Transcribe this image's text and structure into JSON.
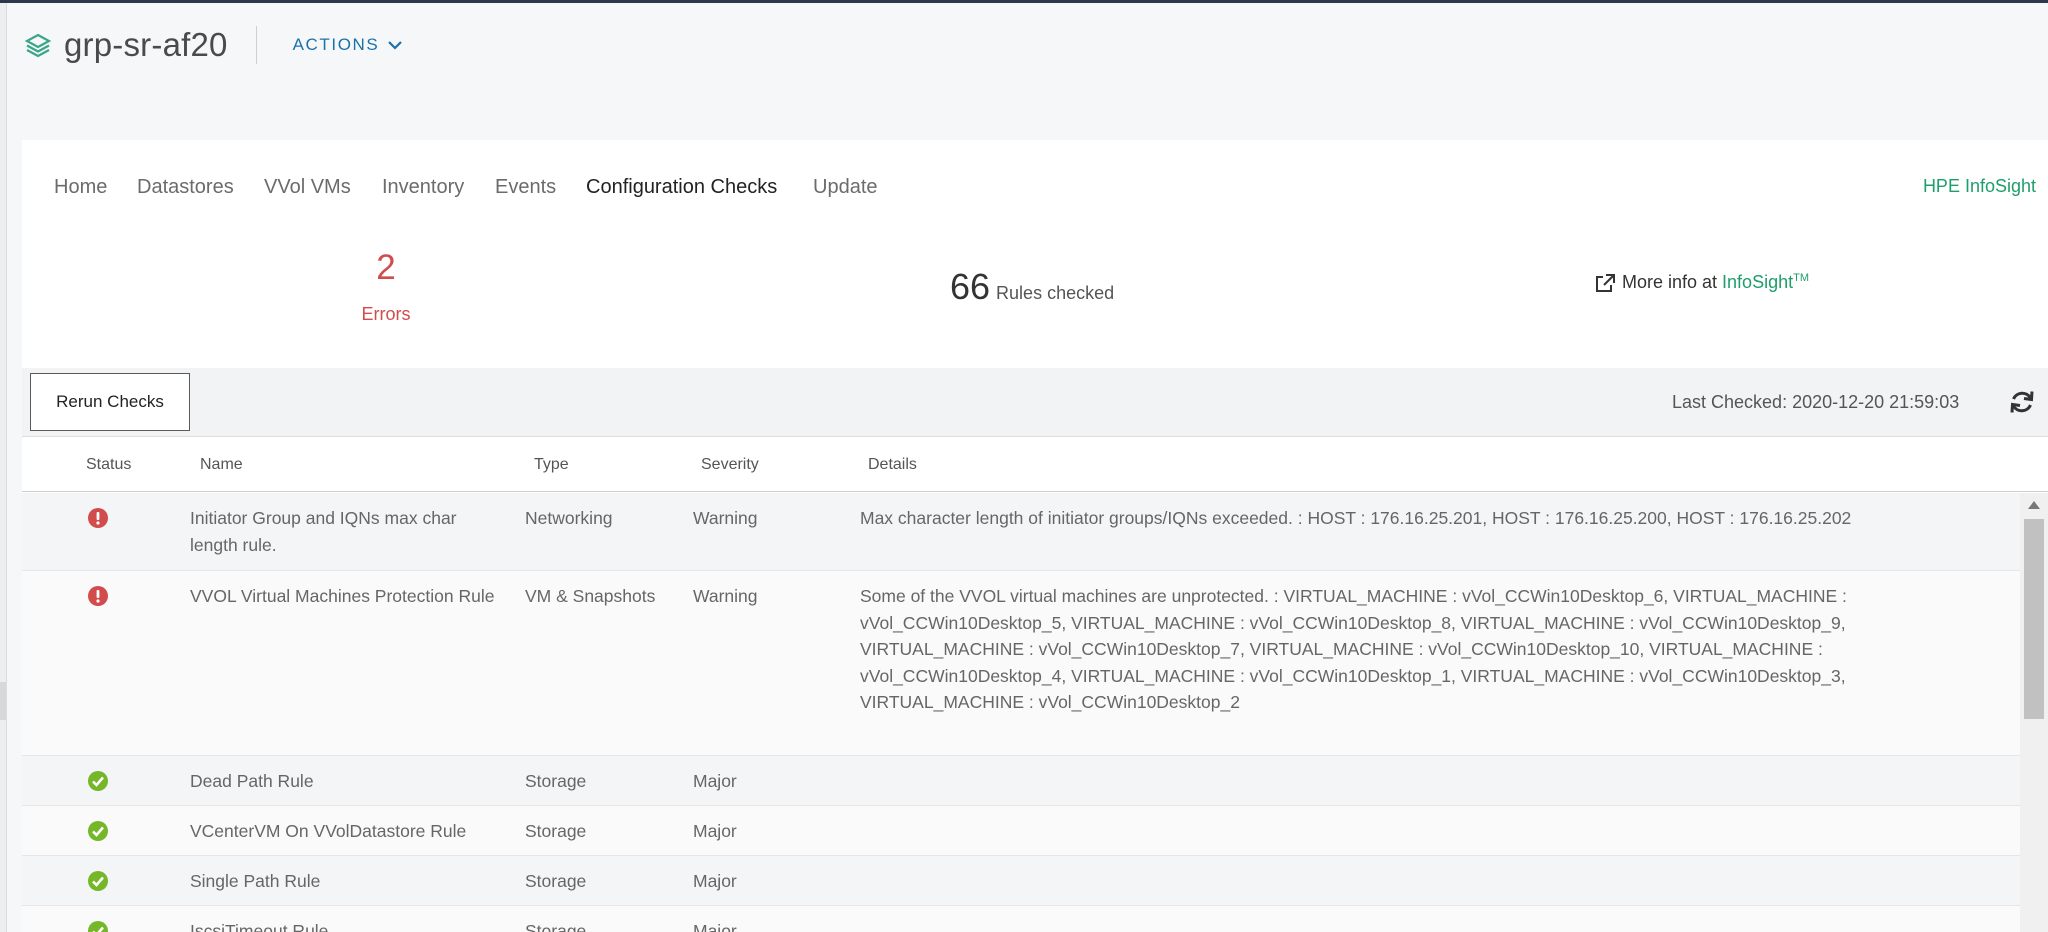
{
  "header": {
    "title": "grp-sr-af20",
    "actions_label": "ACTIONS"
  },
  "tabs": [
    {
      "label": "Home"
    },
    {
      "label": "Datastores"
    },
    {
      "label": "VVol VMs"
    },
    {
      "label": "Inventory"
    },
    {
      "label": "Events"
    },
    {
      "label": "Configuration Checks"
    },
    {
      "label": "Update"
    }
  ],
  "active_tab": "Configuration Checks",
  "infosight_link": "HPE InfoSight",
  "summary": {
    "errors_count": "2",
    "errors_label": "Errors",
    "rules_count": "66",
    "rules_label": "Rules checked",
    "more_info_prefix": "More info at",
    "more_info_link": "InfoSight",
    "more_info_tm": "TM"
  },
  "toolbar": {
    "rerun_label": "Rerun Checks",
    "last_checked": "Last Checked: 2020-12-20 21:59:03"
  },
  "table": {
    "columns": [
      "Status",
      "Name",
      "Type",
      "Severity",
      "Details"
    ],
    "rows": [
      {
        "status": "error",
        "name": "Initiator Group and IQNs max char length rule.",
        "type": "Networking",
        "severity": "Warning",
        "details": "Max character length of initiator groups/IQNs exceeded. : HOST : 176.16.25.201, HOST : 176.16.25.200, HOST : 176.16.25.202"
      },
      {
        "status": "error",
        "name": "VVOL Virtual Machines Protection Rule",
        "type": "VM & Snapshots",
        "severity": "Warning",
        "details": "Some of the VVOL virtual machines are unprotected. : VIRTUAL_MACHINE : vVol_CCWin10Desktop_6, VIRTUAL_MACHINE : vVol_CCWin10Desktop_5, VIRTUAL_MACHINE : vVol_CCWin10Desktop_8, VIRTUAL_MACHINE : vVol_CCWin10Desktop_9, VIRTUAL_MACHINE : vVol_CCWin10Desktop_7, VIRTUAL_MACHINE : vVol_CCWin10Desktop_10, VIRTUAL_MACHINE : vVol_CCWin10Desktop_4, VIRTUAL_MACHINE : vVol_CCWin10Desktop_1, VIRTUAL_MACHINE : vVol_CCWin10Desktop_3, VIRTUAL_MACHINE : vVol_CCWin10Desktop_2"
      },
      {
        "status": "ok",
        "name": "Dead Path Rule",
        "type": "Storage",
        "severity": "Major",
        "details": ""
      },
      {
        "status": "ok",
        "name": "VCenterVM On VVolDatastore Rule",
        "type": "Storage",
        "severity": "Major",
        "details": ""
      },
      {
        "status": "ok",
        "name": "Single Path Rule",
        "type": "Storage",
        "severity": "Major",
        "details": ""
      },
      {
        "status": "ok",
        "name": "IscsiTimeout Rule",
        "type": "Storage",
        "severity": "Major",
        "details": ""
      }
    ]
  },
  "colors": {
    "accent": "#1a73a8",
    "link": "#1e9e6b",
    "error": "#d24c4c",
    "ok": "#76b729"
  },
  "icons": {
    "object": "layers-icon",
    "actions": "chevron-down-icon",
    "external": "external-link-icon",
    "refresh": "refresh-icon",
    "error": "exclamation-circle-icon",
    "ok": "check-circle-icon"
  }
}
